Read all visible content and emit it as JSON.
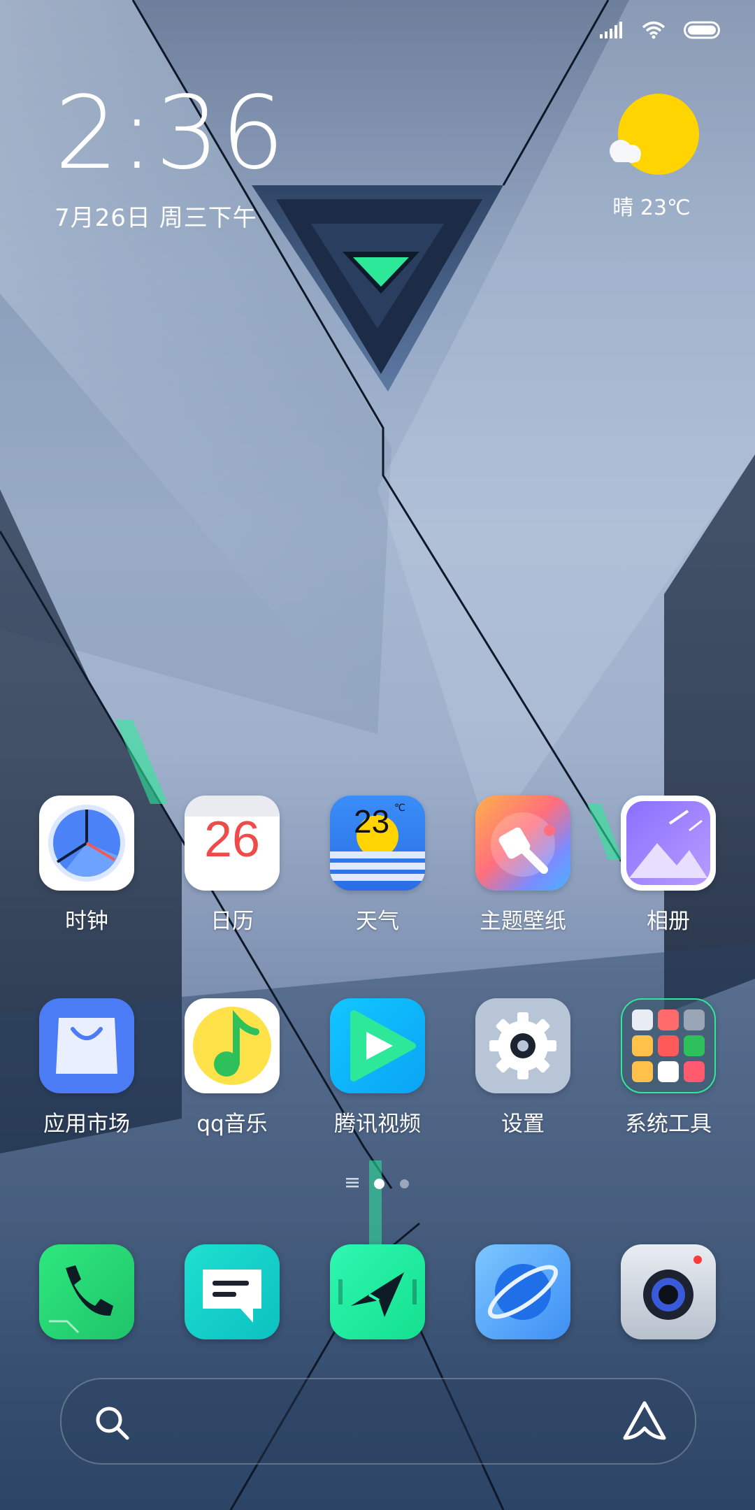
{
  "status_bar": {
    "signal_icon": "signal-icon",
    "wifi_icon": "wifi-icon",
    "battery_icon": "battery-icon"
  },
  "clock_widget": {
    "time": "2:36",
    "date": "7月26日 周三下午"
  },
  "weather_widget": {
    "condition_icon": "sun-cloud-icon",
    "text": "晴 23℃"
  },
  "apps_row1": [
    {
      "label": "时钟",
      "icon": "clock-icon"
    },
    {
      "label": "日历",
      "icon": "calendar-icon",
      "number": "26"
    },
    {
      "label": "天气",
      "icon": "weather-icon",
      "number": "23",
      "unit": "℃"
    },
    {
      "label": "主题壁纸",
      "icon": "themes-icon"
    },
    {
      "label": "相册",
      "icon": "gallery-icon"
    }
  ],
  "apps_row2": [
    {
      "label": "应用市场",
      "icon": "app-store-icon"
    },
    {
      "label": "qq音乐",
      "icon": "qq-music-icon"
    },
    {
      "label": "腾讯视频",
      "icon": "tencent-video-icon"
    },
    {
      "label": "设置",
      "icon": "settings-icon"
    },
    {
      "label": "系统工具",
      "icon": "system-tools-folder-icon"
    }
  ],
  "page_indicator": {
    "pages": 2,
    "current": 1
  },
  "dock": [
    {
      "name": "phone",
      "icon": "phone-icon"
    },
    {
      "name": "messages",
      "icon": "messages-icon"
    },
    {
      "name": "game-turbo",
      "icon": "game-icon"
    },
    {
      "name": "browser",
      "icon": "browser-icon"
    },
    {
      "name": "camera",
      "icon": "camera-icon"
    }
  ],
  "search_bar": {
    "search_icon": "search-icon",
    "assistant_icon": "assistant-icon"
  },
  "colors": {
    "accent_green": "#2ee89a",
    "calendar_red": "#ee4b4b",
    "weather_sun": "#ffd400"
  }
}
